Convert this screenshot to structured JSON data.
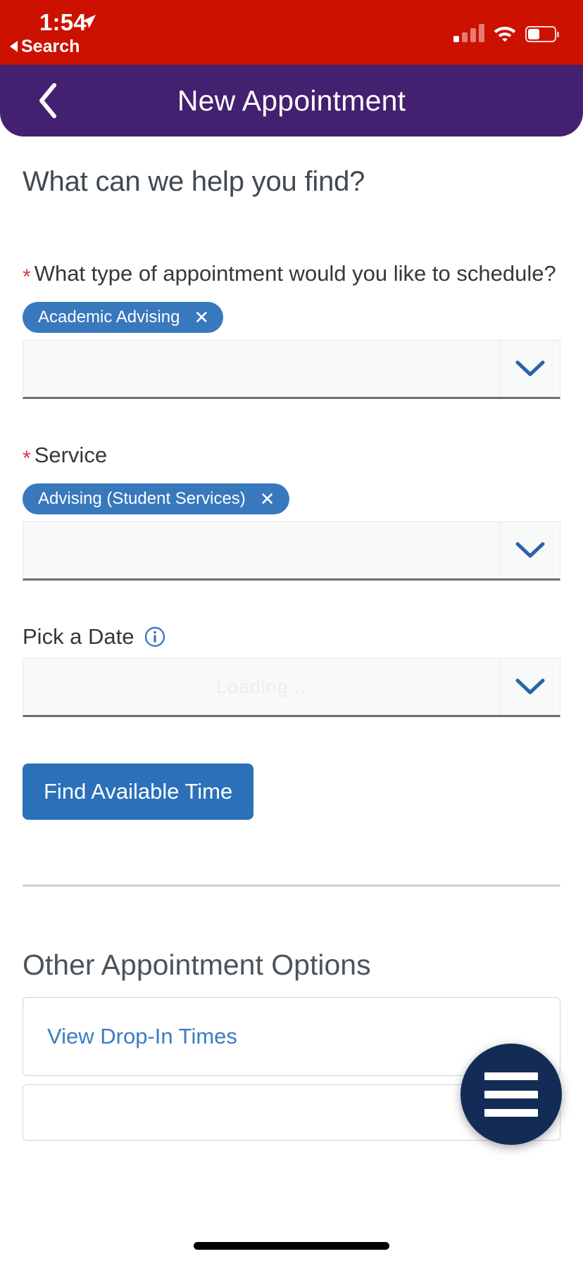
{
  "status_bar": {
    "time": "1:54",
    "back_label": "Search",
    "location_icon": "location-arrow-icon",
    "signal_icon": "cellular-signal-icon",
    "wifi_icon": "wifi-icon",
    "battery_icon": "battery-icon",
    "background_color": "#cc1100"
  },
  "navbar": {
    "title": "New Appointment",
    "back_icon": "chevron-left-icon",
    "background_color": "#432170"
  },
  "page": {
    "heading": "What can we help you find?"
  },
  "fields": {
    "appointment_type": {
      "label": "What type of appointment would you like to schedule?",
      "required_marker": "*",
      "chips": [
        {
          "label": "Academic Advising",
          "remove_icon": "close-icon"
        }
      ],
      "select_value": "",
      "arrow_icon": "chevron-down-icon"
    },
    "service": {
      "label": "Service",
      "required_marker": "*",
      "chips": [
        {
          "label": "Advising (Student Services)",
          "remove_icon": "close-icon"
        }
      ],
      "select_value": "",
      "arrow_icon": "chevron-down-icon"
    },
    "pick_a_date": {
      "label": "Pick a Date",
      "info_icon": "info-circle-icon",
      "select_value": "Loading...",
      "arrow_icon": "chevron-down-icon"
    }
  },
  "actions": {
    "find_available_time": "Find Available Time"
  },
  "other_options": {
    "heading": "Other Appointment Options",
    "cards": [
      {
        "label": "View Drop-In Times"
      },
      {
        "label": ""
      }
    ]
  },
  "fab": {
    "icon": "hamburger-menu-icon",
    "color": "#122c55"
  },
  "colors": {
    "status_red": "#cc1100",
    "nav_purple": "#432170",
    "chip_blue": "#3878bd",
    "button_blue": "#2b70b8",
    "link_blue": "#3b7cc4",
    "required_red": "#cf3b44",
    "fab_navy": "#122c55"
  }
}
